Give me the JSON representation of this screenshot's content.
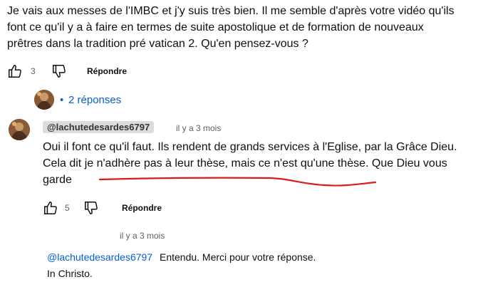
{
  "top_comment": {
    "lines": [
      "Je vais aux messes de l'IMBC et j'y suis très bien. Il me semble d'après votre vidéo qu'ils",
      "font ce qu'il y a à faire en termes de suite apostolique et de formation de nouveaux",
      "prêtres dans la tradition pré vatican 2. Qu'en pensez-vous ?"
    ],
    "likes": "3",
    "reply_label": "Répondre"
  },
  "replies_toggle": {
    "bullet": "•",
    "label": "2 réponses"
  },
  "reply1": {
    "handle": "@lachutedesardes6797",
    "time": "il y a 3 mois",
    "lines": [
      "Oui il font ce qu'il faut. Ils rendent de grands services à l'Eglise, par la Grâce Dieu.",
      "Cela dit je n'adhère pas à leur thèse, mais ce n'est qu'une thèse. Que Dieu vous",
      "garde"
    ],
    "likes": "5",
    "reply_label": "Répondre",
    "underline_color": "#d91c1c"
  },
  "reply2": {
    "time": "il y a 3 mois",
    "mention": "@lachutedesardes6797",
    "text": "Entendu. Merci pour votre réponse.",
    "line2": "In Christo."
  },
  "icons": {
    "like": "thumbs-up-icon",
    "dislike": "thumbs-down-icon"
  },
  "colors": {
    "link_blue": "#065fd4",
    "secondary_text": "#606060",
    "annotation_red": "#d91c1c"
  }
}
